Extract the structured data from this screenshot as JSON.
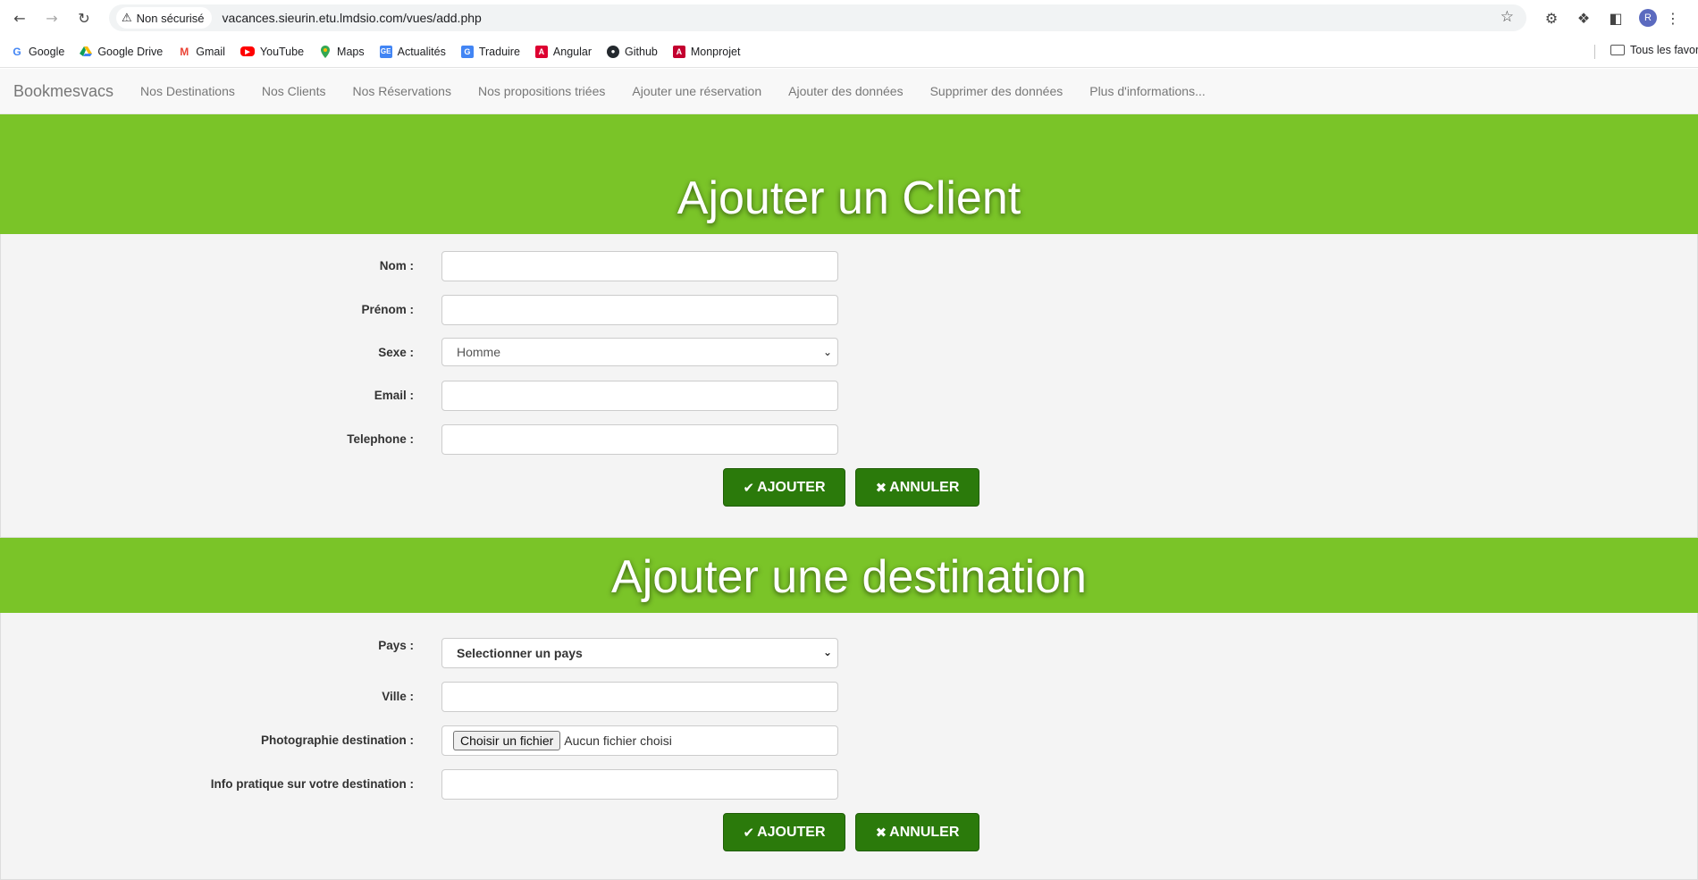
{
  "browser": {
    "security_label": "Non sécurisé",
    "url": "vacances.sieurin.etu.lmdsio.com/vues/add.php",
    "avatar_letter": "R",
    "bookmarks": [
      {
        "label": "Google",
        "icon": "google-icon",
        "color": "#4285f4"
      },
      {
        "label": "Google Drive",
        "icon": "drive-icon",
        "color": "#0f9d58"
      },
      {
        "label": "Gmail",
        "icon": "gmail-icon",
        "color": "#ea4335"
      },
      {
        "label": "YouTube",
        "icon": "youtube-icon",
        "color": "#ff0000"
      },
      {
        "label": "Maps",
        "icon": "maps-icon",
        "color": "#34a853"
      },
      {
        "label": "Actualités",
        "icon": "news-icon",
        "color": "#4285f4"
      },
      {
        "label": "Traduire",
        "icon": "translate-icon",
        "color": "#4285f4"
      },
      {
        "label": "Angular",
        "icon": "angular-icon",
        "color": "#dd0031"
      },
      {
        "label": "Github",
        "icon": "github-icon",
        "color": "#24292e"
      },
      {
        "label": "Monprojet",
        "icon": "angular-icon",
        "color": "#c3002f"
      }
    ],
    "all_bookmarks_label": "Tous les favori"
  },
  "site_nav": {
    "brand": "Bookmesvacs",
    "links": [
      "Nos Destinations",
      "Nos Clients",
      "Nos Réservations",
      "Nos propositions triées",
      "Ajouter une réservation",
      "Ajouter des données",
      "Supprimer des données",
      "Plus d'informations..."
    ]
  },
  "client_form": {
    "title": "Ajouter un Client",
    "fields": {
      "nom": {
        "label": "Nom :",
        "value": ""
      },
      "prenom": {
        "label": "Prénom :",
        "value": ""
      },
      "sexe": {
        "label": "Sexe :",
        "selected": "Homme"
      },
      "email": {
        "label": "Email :",
        "value": ""
      },
      "telephone": {
        "label": "Telephone :",
        "value": ""
      }
    },
    "add_label": "AJOUTER",
    "cancel_label": "ANNULER"
  },
  "destination_form": {
    "title": "Ajouter une destination",
    "fields": {
      "pays": {
        "label": "Pays :",
        "selected": "Selectionner un pays"
      },
      "ville": {
        "label": "Ville :",
        "value": ""
      },
      "photo": {
        "label": "Photographie destination :",
        "button": "Choisir un fichier",
        "status": "Aucun fichier choisi"
      },
      "info": {
        "label": "Info pratique sur votre destination :",
        "value": ""
      }
    },
    "add_label": "AJOUTER",
    "cancel_label": "ANNULER"
  },
  "colors": {
    "accent_green": "#7ac428",
    "button_green": "#2b7a0b"
  }
}
